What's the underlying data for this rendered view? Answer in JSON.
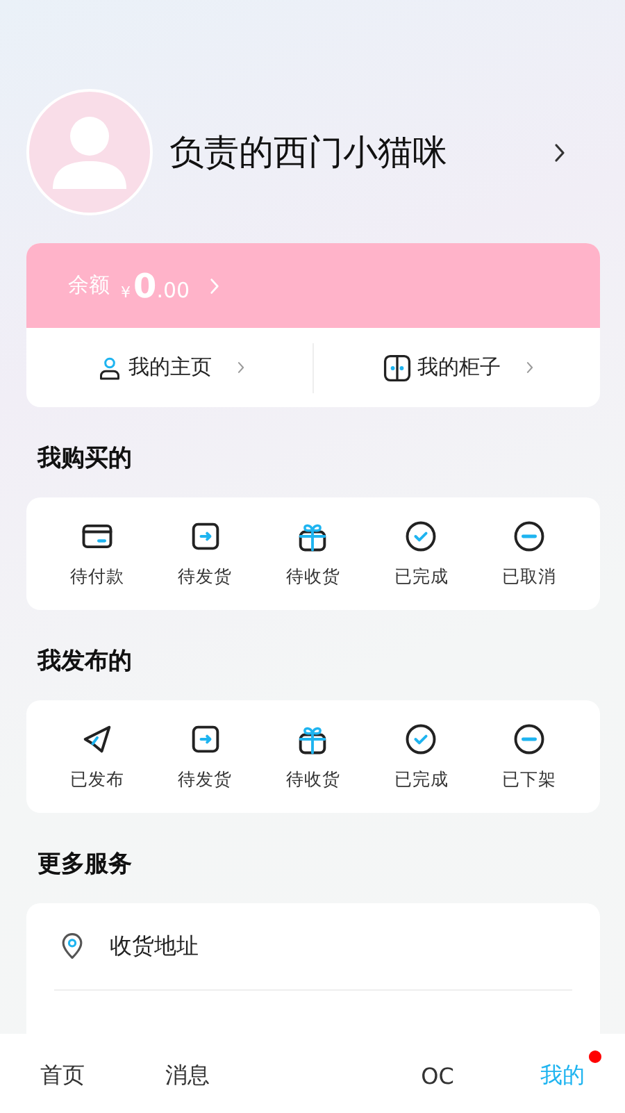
{
  "profile": {
    "name": "负责的西门小猫咪"
  },
  "balance": {
    "label": "余额",
    "currency": "¥",
    "integer": "0",
    "decimals": ".00"
  },
  "shortcuts": [
    {
      "label": "我的主页",
      "kind": "person"
    },
    {
      "label": "我的柜子",
      "kind": "cabinet"
    }
  ],
  "bought": {
    "title": "我购买的",
    "items": [
      {
        "label": "待付款",
        "kind": "wallet"
      },
      {
        "label": "待发货",
        "kind": "arrow-box"
      },
      {
        "label": "待收货",
        "kind": "gift"
      },
      {
        "label": "已完成",
        "kind": "check"
      },
      {
        "label": "已取消",
        "kind": "minus"
      }
    ]
  },
  "published": {
    "title": "我发布的",
    "items": [
      {
        "label": "已发布",
        "kind": "plane"
      },
      {
        "label": "待发货",
        "kind": "arrow-box"
      },
      {
        "label": "待收货",
        "kind": "gift"
      },
      {
        "label": "已完成",
        "kind": "check"
      },
      {
        "label": "已下架",
        "kind": "minus"
      }
    ]
  },
  "services": {
    "title": "更多服务",
    "items": [
      {
        "label": "收货地址",
        "kind": "location"
      }
    ]
  },
  "tabbar": [
    {
      "label": "首页",
      "selected": false,
      "dot": false
    },
    {
      "label": "消息",
      "selected": false,
      "dot": false
    },
    {
      "label": "OC",
      "selected": false,
      "dot": false
    },
    {
      "label": "我的",
      "selected": true,
      "dot": true
    }
  ]
}
